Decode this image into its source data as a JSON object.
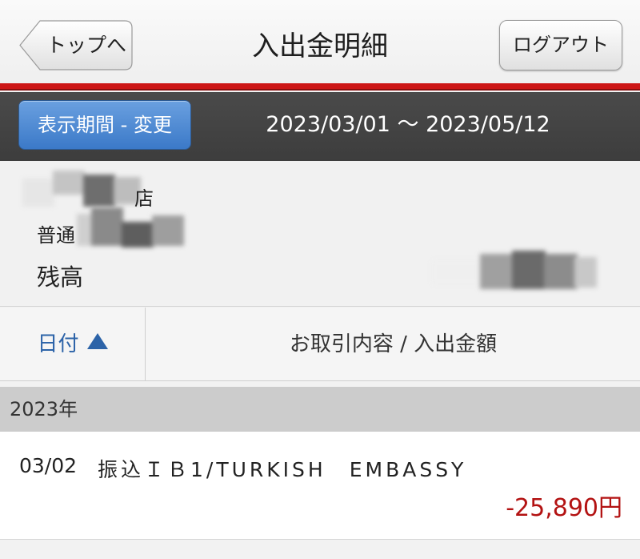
{
  "header": {
    "back_label": "トップへ",
    "title": "入出金明細",
    "logout_label": "ログアウト"
  },
  "period": {
    "button_label": "表示期間 - 変更",
    "range": "2023/03/01 〜 2023/05/12"
  },
  "account": {
    "branch_suffix": "店",
    "type_label": "普通",
    "balance_label": "残高",
    "balance_suffix": "円"
  },
  "columns": {
    "date_label": "日付",
    "content_label": "お取引内容 / 入出金額"
  },
  "groups": [
    {
      "year_label": "2023年",
      "transactions": [
        {
          "date": "03/02",
          "description": "振込ＩＢ1/TURKISH　EMBASSY",
          "amount": "-25,890円"
        }
      ]
    }
  ],
  "colors": {
    "accent_red": "#cc1616",
    "button_blue": "#3b79c8",
    "negative_amount": "#b31212",
    "date_header_blue": "#2c63a8"
  },
  "icons": {
    "sort": "triangle-up-icon"
  }
}
